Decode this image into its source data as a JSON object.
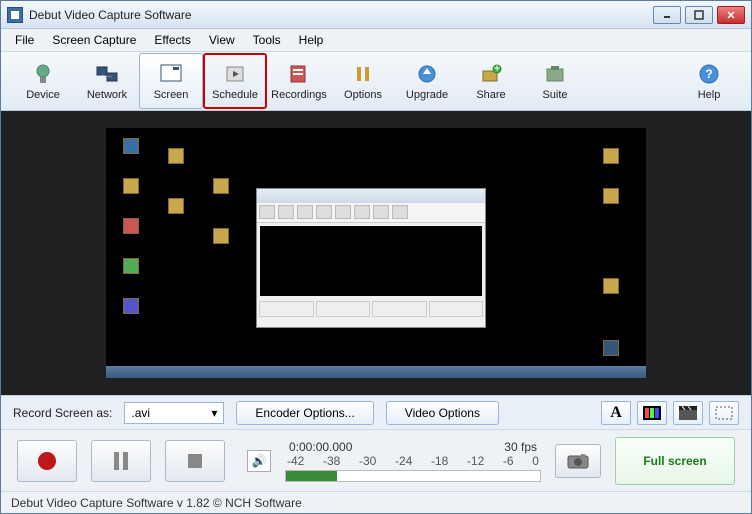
{
  "window": {
    "title": "Debut Video Capture Software"
  },
  "menu": {
    "items": [
      "File",
      "Screen Capture",
      "Effects",
      "View",
      "Tools",
      "Help"
    ]
  },
  "toolbar": {
    "items": [
      {
        "label": "Device",
        "icon": "device-icon"
      },
      {
        "label": "Network",
        "icon": "network-icon"
      },
      {
        "label": "Screen",
        "icon": "screen-icon",
        "active": true
      },
      {
        "label": "Schedule",
        "icon": "schedule-icon",
        "highlight": true
      },
      {
        "label": "Recordings",
        "icon": "recordings-icon"
      },
      {
        "label": "Options",
        "icon": "options-icon"
      },
      {
        "label": "Upgrade",
        "icon": "upgrade-icon"
      },
      {
        "label": "Share",
        "icon": "share-icon"
      },
      {
        "label": "Suite",
        "icon": "suite-icon"
      }
    ],
    "help_label": "Help"
  },
  "options_row": {
    "label": "Record Screen as:",
    "format_value": ".avi",
    "encoder_btn": "Encoder Options...",
    "video_btn": "Video Options"
  },
  "controls": {
    "timecode": "0:00:00.000",
    "fps": "30 fps",
    "ticks": [
      "-42",
      "-38",
      "-30",
      "-24",
      "-18",
      "-12",
      "-6",
      "0"
    ],
    "fullscreen": "Full screen"
  },
  "status": {
    "text": "Debut Video Capture Software v 1.82 © NCH Software"
  }
}
